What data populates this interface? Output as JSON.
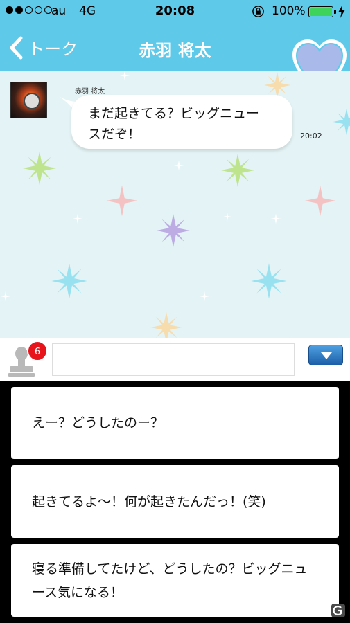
{
  "status_bar": {
    "carrier": "au",
    "network": "4G",
    "time": "20:08",
    "battery_percent": "100%",
    "battery_level": 1.0,
    "signal_dots": 5,
    "signal_filled": 2
  },
  "nav": {
    "back_label": "トーク",
    "title": "赤羽 将太",
    "accent_color": "#5ec9e8"
  },
  "chat": {
    "messages": [
      {
        "sender": "赤羽 将太",
        "text_line1": "まだ起きてる？ビッグニュー",
        "text_line2": "スだぞ！",
        "time": "20:02"
      }
    ]
  },
  "input_bar": {
    "stamp_badge": "6",
    "input_value": "",
    "input_placeholder": ""
  },
  "replies": [
    {
      "line1": "えー？どうしたのー？",
      "line2": ""
    },
    {
      "line1": "起きてるよ～！何が起きたんだっ！(笑)",
      "line2": ""
    },
    {
      "line1": "寝る準備してたけど、どうしたの？ビッグニュ",
      "line2": "ース気になる！"
    }
  ],
  "icons": {
    "back": "chevron-left-icon",
    "heart": "heart-icon",
    "stamp": "stamp-icon",
    "toggle": "triangle-down-icon",
    "lock": "rotation-lock-icon",
    "bolt": "charging-bolt-icon"
  }
}
